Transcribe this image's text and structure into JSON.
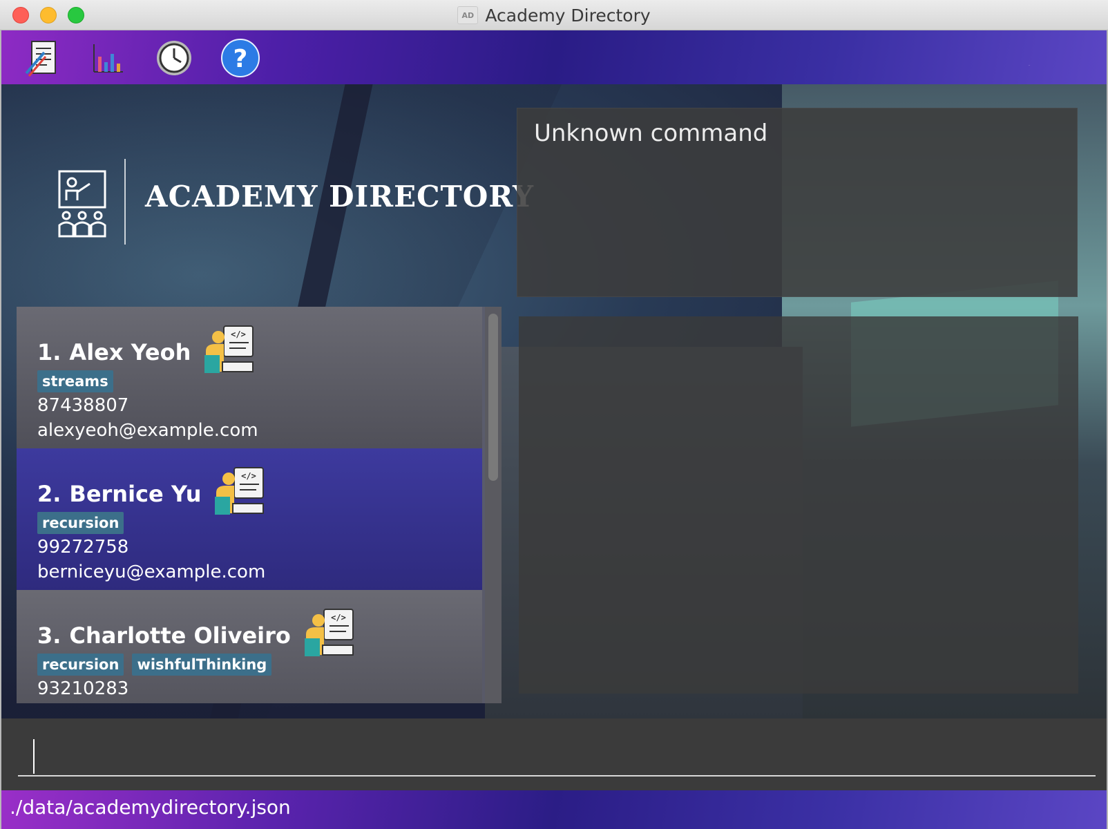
{
  "window": {
    "title": "Academy Directory",
    "app_icon_text": "AD"
  },
  "toolbar": {
    "buttons": [
      {
        "name": "report-icon"
      },
      {
        "name": "chart-icon"
      },
      {
        "name": "clock-icon"
      },
      {
        "name": "help-icon",
        "glyph": "?"
      }
    ]
  },
  "brand": {
    "title": "ACADEMY DIRECTORY"
  },
  "result": {
    "text": "Unknown command"
  },
  "students": [
    {
      "index": "1.",
      "name": "Alex Yeoh",
      "tags": [
        "streams"
      ],
      "phone": "87438807",
      "email": "alexyeoh@example.com",
      "selected": false
    },
    {
      "index": "2.",
      "name": "Bernice Yu",
      "tags": [
        "recursion"
      ],
      "phone": "99272758",
      "email": "berniceyu@example.com",
      "selected": true
    },
    {
      "index": "3.",
      "name": "Charlotte Oliveiro",
      "tags": [
        "recursion",
        "wishfulThinking"
      ],
      "phone": "93210283",
      "email": "",
      "selected": false
    }
  ],
  "command": {
    "value": ""
  },
  "status": {
    "path": "./data/academydirectory.json"
  },
  "colors": {
    "accent": "#3c3a9e",
    "tag": "#3c6f8a",
    "toolbar": "#4d1fa8"
  }
}
